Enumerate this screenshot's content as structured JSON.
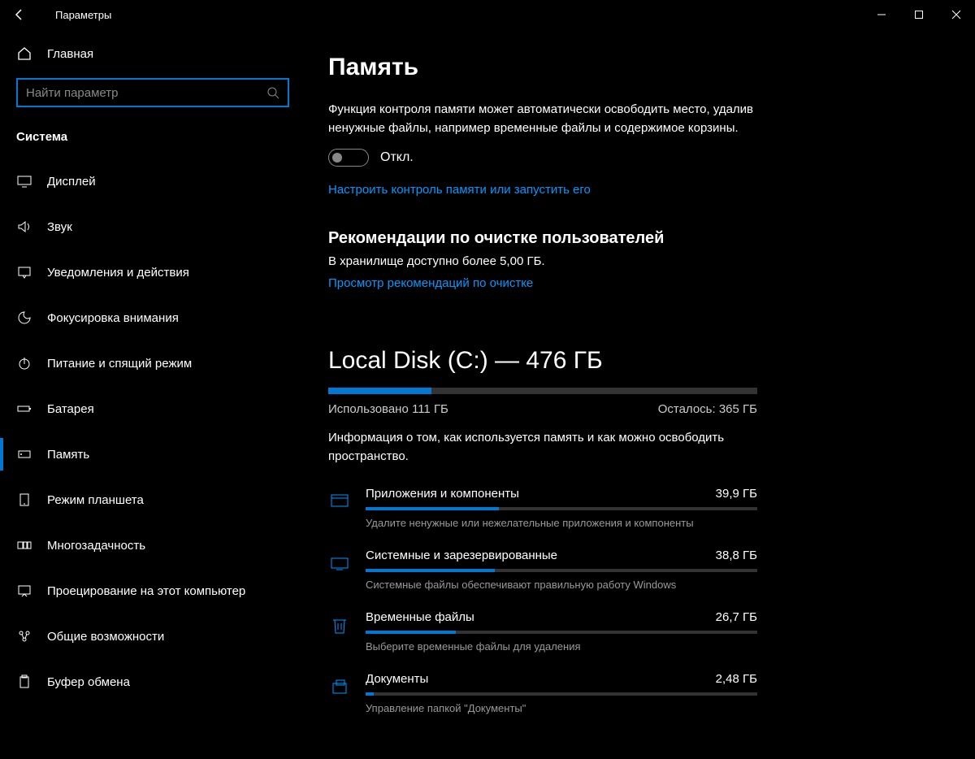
{
  "titlebar": {
    "title": "Параметры"
  },
  "sidebar": {
    "home": "Главная",
    "search_placeholder": "Найти параметр",
    "section": "Система",
    "items": [
      {
        "id": "display",
        "label": "Дисплей"
      },
      {
        "id": "sound",
        "label": "Звук"
      },
      {
        "id": "notifications",
        "label": "Уведомления и действия"
      },
      {
        "id": "focus",
        "label": "Фокусировка внимания"
      },
      {
        "id": "power",
        "label": "Питание и спящий режим"
      },
      {
        "id": "battery",
        "label": "Батарея"
      },
      {
        "id": "storage",
        "label": "Память"
      },
      {
        "id": "tablet",
        "label": "Режим планшета"
      },
      {
        "id": "multitask",
        "label": "Многозадачность"
      },
      {
        "id": "projecting",
        "label": "Проецирование на этот компьютер"
      },
      {
        "id": "shared",
        "label": "Общие возможности"
      },
      {
        "id": "clipboard",
        "label": "Буфер обмена"
      }
    ]
  },
  "page": {
    "title": "Память",
    "sense_desc": "Функция контроля памяти может автоматически освободить место, удалив ненужные файлы, например временные файлы и содержимое корзины.",
    "toggle_label": "Откл.",
    "sense_link": "Настроить контроль памяти или запустить его",
    "cleanup_head": "Рекомендации по очистке пользователей",
    "cleanup_text": "В хранилище доступно более 5,00 ГБ.",
    "cleanup_link": "Просмотр рекомендаций по очистке",
    "disk_title": "Local Disk (C:) — 476 ГБ",
    "disk_used": "Использовано 111 ГБ",
    "disk_free": "Осталось: 365 ГБ",
    "disk_fill_pct": 24,
    "disk_desc": "Информация о том, как используется память и как можно освободить пространство.",
    "categories": [
      {
        "name": "Приложения и компоненты",
        "size": "39,9 ГБ",
        "pct": 34,
        "desc": "Удалите ненужные или нежелательные приложения и компоненты",
        "icon": "apps"
      },
      {
        "name": "Системные и зарезервированные",
        "size": "38,8 ГБ",
        "pct": 33,
        "desc": "Системные файлы обеспечивают правильную работу Windows",
        "icon": "system"
      },
      {
        "name": "Временные файлы",
        "size": "26,7 ГБ",
        "pct": 23,
        "desc": "Выберите временные файлы для удаления",
        "icon": "trash"
      },
      {
        "name": "Документы",
        "size": "2,48 ГБ",
        "pct": 2,
        "desc": "Управление папкой \"Документы\"",
        "icon": "docs"
      }
    ]
  }
}
